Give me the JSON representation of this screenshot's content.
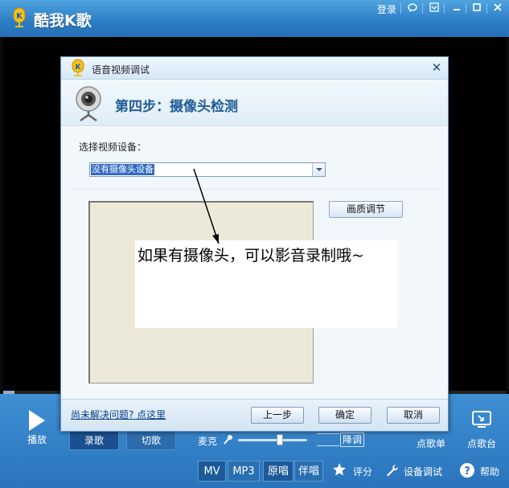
{
  "app": {
    "title": "酷我K歌",
    "login": "登录"
  },
  "playback": {
    "play_label": "播放",
    "tabs": [
      "录歌",
      "切歌"
    ],
    "mic_label": "麦克",
    "pitch_down": "降调",
    "right": [
      "点歌单",
      "点歌台"
    ]
  },
  "toolbar": {
    "formats": [
      "MV",
      "MP3",
      "原唱",
      "伴唱"
    ],
    "score": "评分",
    "device_test": "设备调试",
    "help": "帮助"
  },
  "dialog": {
    "title": "语音视频调试",
    "step_title": "第四步：摄像头检测",
    "select_label": "选择视频设备：",
    "device_value": "没有摄像头设备",
    "quality_button": "画质调节",
    "help_link": "尚未解决问题? 点这里",
    "prev_button": "上一步",
    "ok_button": "确定",
    "cancel_button": "取消"
  },
  "annotation": {
    "text": "如果有摄像头，可以影音录制哦~"
  },
  "colors": {
    "titlebar": "#2c7cc4",
    "dialog_header_text": "#1f5b96",
    "selection": "#316ac5"
  }
}
